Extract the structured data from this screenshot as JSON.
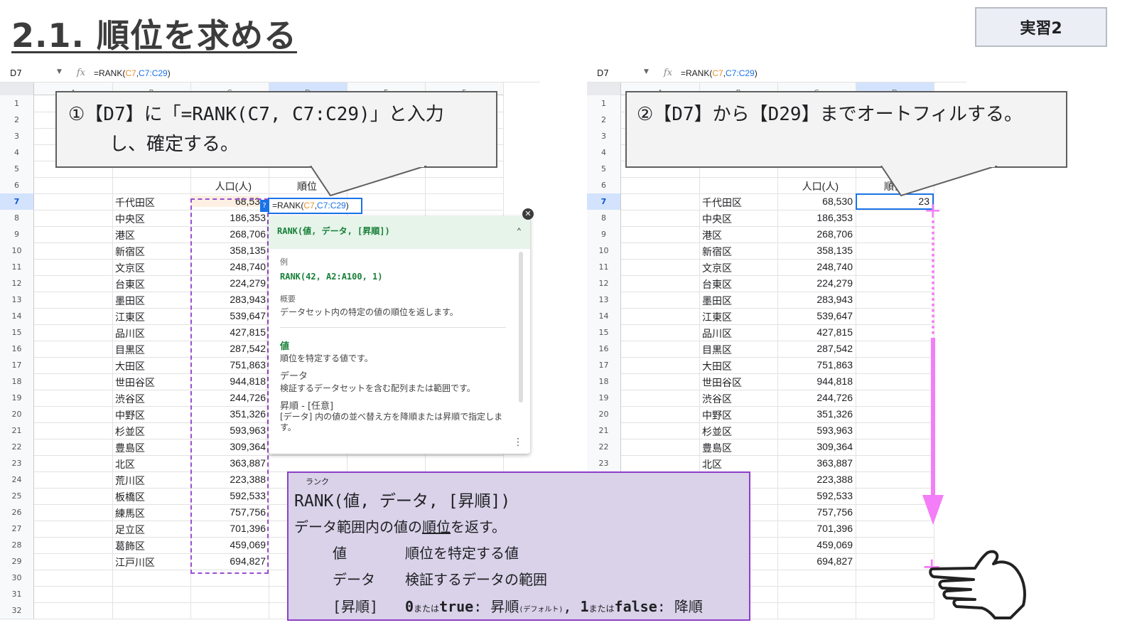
{
  "title": "2.1. 順位を求める",
  "badge": "実習2",
  "left_sheet": {
    "name_box": "D7",
    "formula_prefix": "=RANK(",
    "formula_arg1": "C7",
    "formula_comma": ",",
    "formula_arg2": "C7:C29",
    "formula_suffix": ")",
    "col_headers": [
      "A",
      "B",
      "C",
      "D",
      "E",
      "F"
    ],
    "header_population": "人口(人)",
    "header_rank": "順位",
    "active_cell_value": "68,53",
    "callout_line1": "①【D7】に「=RANK(C7, C7:C29)」と入力",
    "callout_line2": "し、確定する。",
    "help_badge": "?",
    "help": {
      "header": "RANK(値, データ, [昇順])",
      "example_label": "例",
      "example": "RANK(42, A2:A100, 1)",
      "summary_label": "概要",
      "summary": "データセット内の特定の値の順位を返します。",
      "arg1_name": "値",
      "arg1_desc": "順位を特定する値です。",
      "arg2_name": "データ",
      "arg2_desc": "検証するデータセットを含む配列または範囲です。",
      "arg3_name": "昇順 - [任意]",
      "arg3_desc": "[データ] 内の値の並べ替え方を降順または昇順で指定します。"
    }
  },
  "right_sheet": {
    "name_box": "D7",
    "formula_prefix": "=RANK(",
    "formula_arg1": "C7",
    "formula_comma": ",",
    "formula_arg2": "C7:C29",
    "formula_suffix": ")",
    "col_headers": [
      "A",
      "B",
      "C",
      "D"
    ],
    "header_population": "人口(人)",
    "header_rank": "順位",
    "d7_value": "23",
    "callout_text": "②【D7】から【D29】までオートフィルする。"
  },
  "row_numbers": [
    "1",
    "2",
    "3",
    "4",
    "5",
    "6",
    "7",
    "8",
    "9",
    "10",
    "11",
    "12",
    "13",
    "14",
    "15",
    "16",
    "17",
    "18",
    "19",
    "20",
    "21",
    "22",
    "23",
    "24",
    "25",
    "26",
    "27",
    "28",
    "29",
    "30",
    "31",
    "32"
  ],
  "wards": [
    "千代田区",
    "中央区",
    "港区",
    "新宿区",
    "文京区",
    "台東区",
    "墨田区",
    "江東区",
    "品川区",
    "目黒区",
    "大田区",
    "世田谷区",
    "渋谷区",
    "中野区",
    "杉並区",
    "豊島区",
    "北区",
    "荒川区",
    "板橋区",
    "練馬区",
    "足立区",
    "葛飾区",
    "江戸川区"
  ],
  "populations": [
    "68,530",
    "186,353",
    "268,706",
    "358,135",
    "248,740",
    "224,279",
    "283,943",
    "539,647",
    "427,815",
    "287,542",
    "751,863",
    "944,818",
    "244,726",
    "351,326",
    "593,963",
    "309,364",
    "363,887",
    "223,388",
    "592,533",
    "757,756",
    "701,396",
    "459,069",
    "694,827"
  ],
  "explain": {
    "ruby": "ランク",
    "syntax": "RANK(値, データ, [昇順])",
    "desc_before": "データ範囲内の値の",
    "desc_underlined": "順位",
    "desc_after": "を返す。",
    "arg1_name": "値",
    "arg1_desc": "順位を特定する値",
    "arg2_name": "データ",
    "arg2_desc": "検証するデータの範囲",
    "arg3_name": "[昇順]",
    "opt0_value": "0",
    "opt0_or": "または",
    "opt0_bool": "true",
    "opt0_label": ": 昇順",
    "opt0_note": "(デフォルト)",
    "opt_sep": ",",
    "opt1_value": "1",
    "opt1_or": "または",
    "opt1_bool": "false",
    "opt1_label": ": 降順"
  },
  "colors": {
    "accent_pink": "#f37ef7",
    "selection_blue": "#1a73e8",
    "help_green": "#188038",
    "explain_bg": "#d9d2e9",
    "explain_border": "#8e3fc9"
  },
  "icons": [
    "fx-icon",
    "dropdown-arrow-icon",
    "close-icon",
    "chevron-up-icon",
    "more-vert-icon",
    "pointing-hand-icon",
    "fill-handle-cross-icon",
    "down-arrow-icon"
  ]
}
